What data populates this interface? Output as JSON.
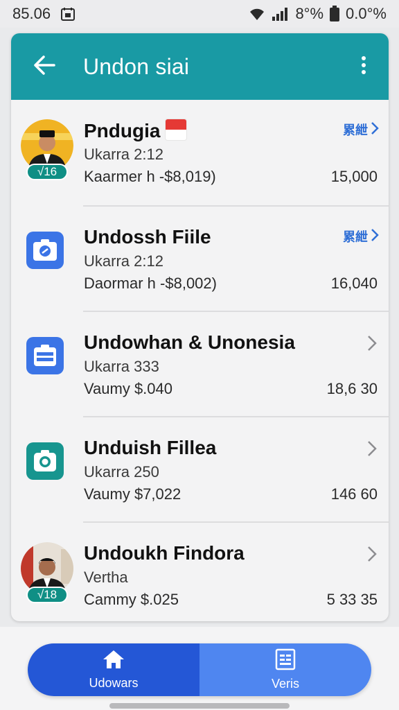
{
  "status_bar": {
    "time": "85.06",
    "battery_percent": "8°%",
    "data_rate": "0.0°%",
    "icons": [
      "calendar-icon",
      "wifi-icon",
      "signal-icon",
      "battery-icon"
    ]
  },
  "app_bar": {
    "title": "Undon siai",
    "back_icon": "arrow-left-icon",
    "menu_icon": "more-vert-icon",
    "color": "#199aa4"
  },
  "items": [
    {
      "name": "Pndugia",
      "subtitle": "Ukarra 2:12",
      "description": "Kaarmer h -$8,019)",
      "amount": "15,000",
      "badge": "√16",
      "action_label": "累紲",
      "avatar": "person-photo",
      "flag": "indonesia-flag-icon"
    },
    {
      "name": "Undossh Fiile",
      "subtitle": "Ukarra 2:12",
      "description": "Daormar h -$8,002)",
      "amount": "16,040",
      "action_label": "累紲",
      "icon": "camera-app-icon"
    },
    {
      "name": "Undowhan & Unonesia",
      "subtitle": "Ukarra 333",
      "description": "Vaumy  $.040",
      "amount": "18,6 30",
      "icon": "document-app-icon"
    },
    {
      "name": "Unduish Fillea",
      "subtitle": "Ukarra 250",
      "description": "Vaumy  $7,022",
      "amount": "146 60",
      "icon": "camera-teal-app-icon"
    },
    {
      "name": "Undoukh Findora",
      "subtitle": "Vertha",
      "description": "Cammy  $.025",
      "amount": "5 33 35",
      "badge": "√18",
      "avatar": "person-photo"
    }
  ],
  "bottom_nav": {
    "tabs": [
      {
        "label": "Udowars",
        "icon": "home-icon"
      },
      {
        "label": "Veris",
        "icon": "list-document-icon"
      }
    ]
  },
  "colors": {
    "accent": "#199aa4",
    "link": "#2f6fd6",
    "nav_primary": "#2457d6",
    "nav_secondary": "#4f86f0",
    "badge": "#0f8f85"
  }
}
